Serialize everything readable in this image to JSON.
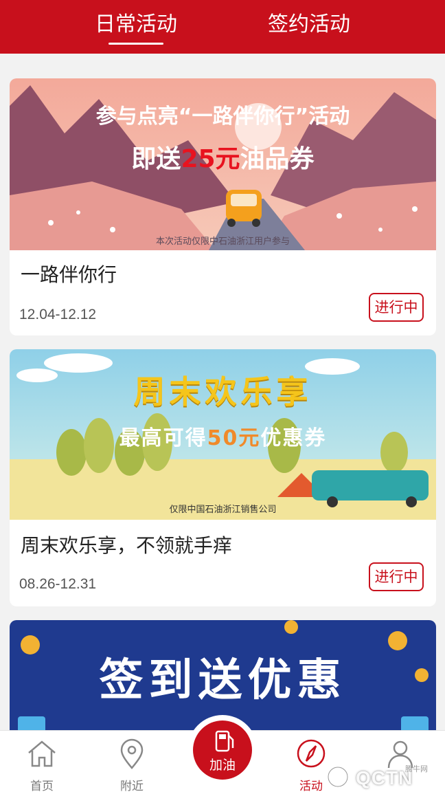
{
  "header": {
    "tabs": [
      {
        "label": "日常活动",
        "active": true
      },
      {
        "label": "签约活动",
        "active": false
      }
    ]
  },
  "cards": [
    {
      "banner_line1": "参与点亮“一路伴你行”活动",
      "banner_line2_prefix": "即送",
      "banner_line2_highlight": "25元",
      "banner_line2_suffix": "油品券",
      "banner_footnote": "本次活动仅限中石油浙江用户参与",
      "title": "一路伴你行",
      "date": "12.04-12.12",
      "status": "进行中"
    },
    {
      "banner_line1": "周末欢乐享",
      "banner_line2_prefix": "最高可得",
      "banner_line2_highlight": "50元",
      "banner_line2_suffix": "优惠券",
      "banner_footnote": "仅限中国石油浙江销售公司",
      "title": "周末欢乐享，不领就手痒",
      "date": "08.26-12.31",
      "status": "进行中"
    },
    {
      "banner_line1": "签到送优惠"
    }
  ],
  "bottom_nav": {
    "items": [
      {
        "label": "首页",
        "icon": "home-icon",
        "active": false
      },
      {
        "label": "附近",
        "icon": "location-pin-icon",
        "active": false
      },
      {
        "label": "加油",
        "icon": "fuel-pump-icon",
        "active": false
      },
      {
        "label": "活动",
        "icon": "compass-icon",
        "active": true
      }
    ]
  },
  "watermark": {
    "text": "QCTN",
    "small": "腾牛网"
  },
  "colors": {
    "brand_red": "#c8101c",
    "page_bg": "#f2f2f2"
  }
}
